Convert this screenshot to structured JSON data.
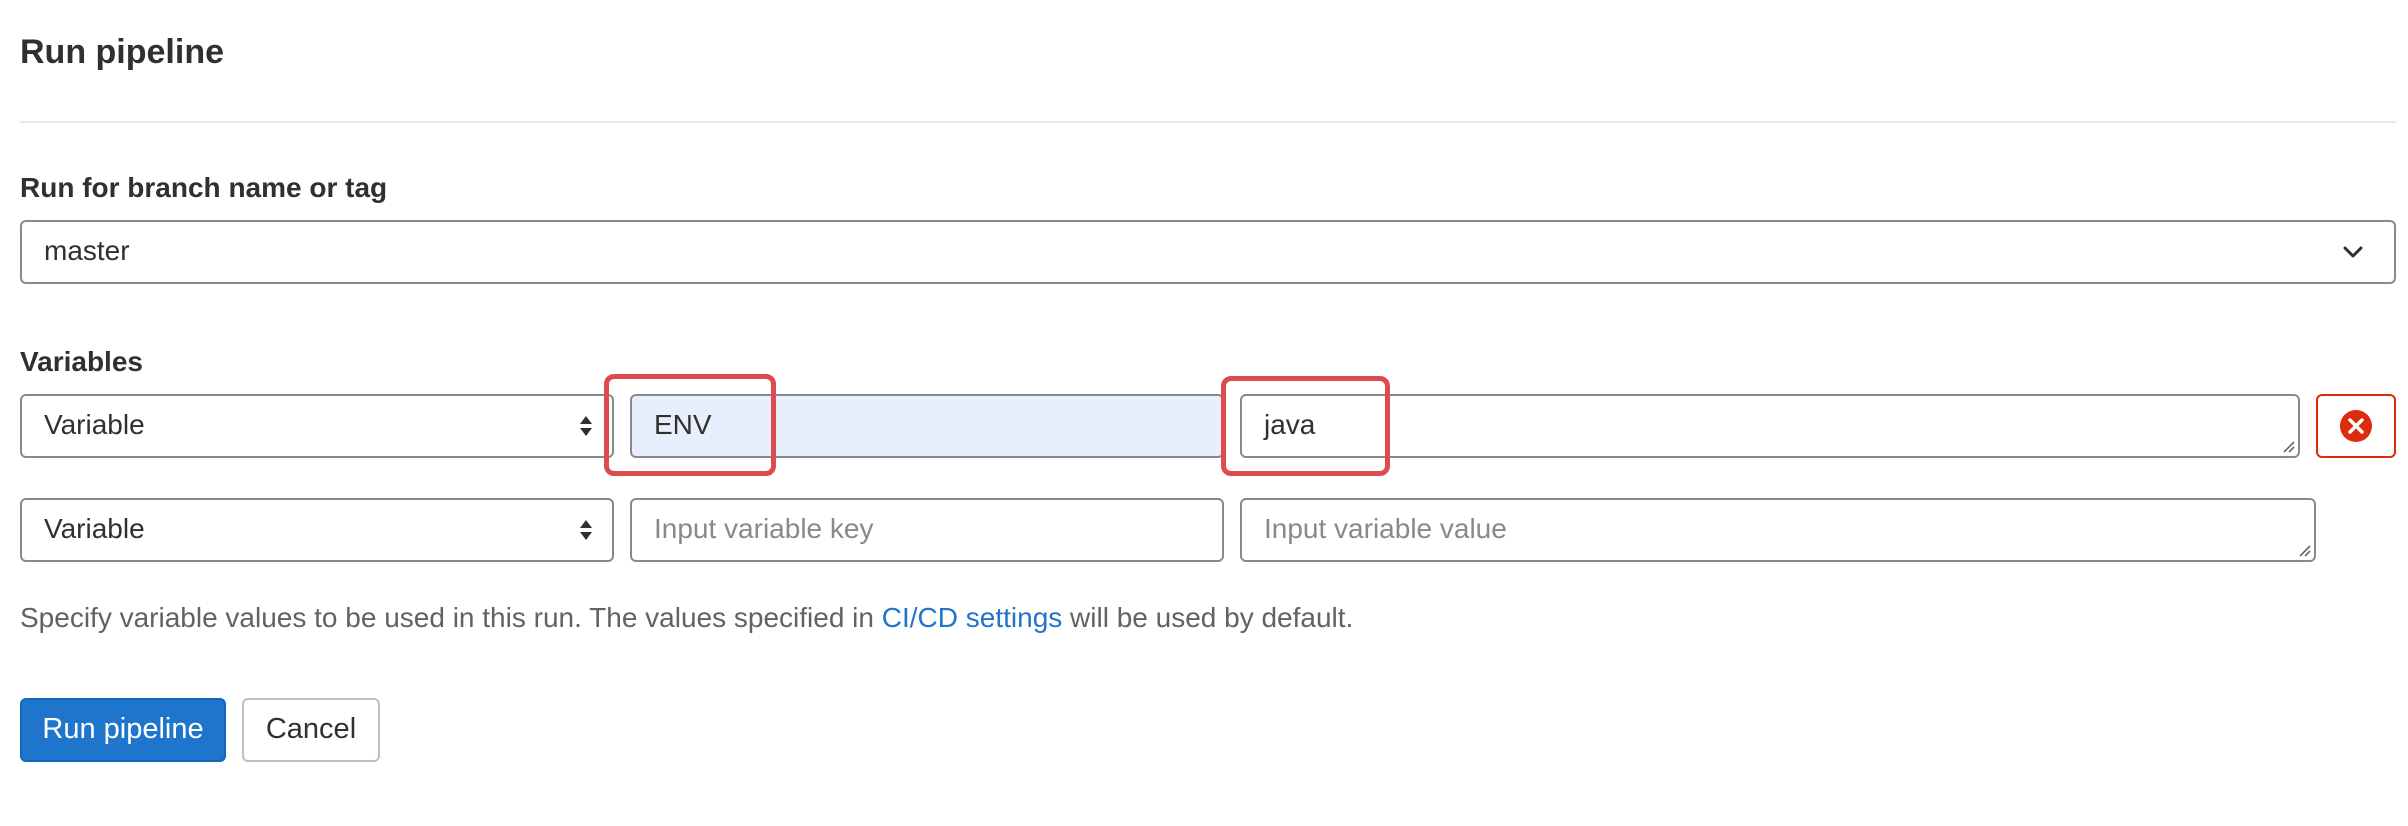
{
  "page": {
    "title": "Run pipeline"
  },
  "branch": {
    "label": "Run for branch name or tag",
    "value": "master"
  },
  "variables": {
    "label": "Variables",
    "rows": [
      {
        "type": "Variable",
        "key": "ENV",
        "value": "java"
      },
      {
        "type": "Variable",
        "key_placeholder": "Input variable key",
        "value_placeholder": "Input variable value"
      }
    ]
  },
  "help": {
    "text_before": "Specify variable values to be used in this run. The values specified in ",
    "link": "CI/CD settings",
    "text_after": " will be used by default."
  },
  "actions": {
    "run": "Run pipeline",
    "cancel": "Cancel"
  },
  "colors": {
    "primary": "#1f75cb",
    "danger": "#dd2b0e",
    "highlight": "#dd4b4f",
    "focus_bg": "#e7effc"
  },
  "icons": {
    "select": "sort-arrows-icon",
    "dropdown": "chevron-down-icon",
    "remove": "remove-icon"
  }
}
